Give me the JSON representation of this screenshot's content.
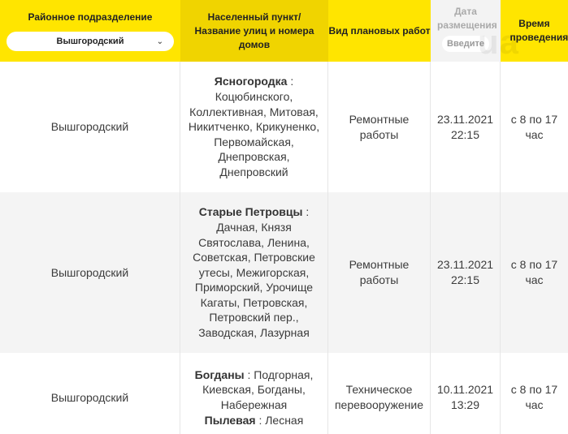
{
  "header": {
    "district_label": "Районное подразделение",
    "district_selected": "Вышгородский",
    "address_label": "Населенный пункт/Название улиц и номера домов",
    "work_type_label": "Вид плановых работ",
    "date_label": "Дата размещения",
    "date_placeholder": "Введите",
    "time_label": "Время проведения"
  },
  "watermark": "ua",
  "rows": [
    {
      "district": "Вышгородский",
      "places": [
        {
          "name": "Ясногородка",
          "streets": " : Коцюбинского, Коллективная, Митовая, Никитченко, Крикуненко, Первомайская, Днепровская, Днепровский"
        }
      ],
      "work_type": "Ремонтные работы",
      "date": "23.11.2021 22:15",
      "time": "с 8 по 17 час"
    },
    {
      "district": "Вышгородский",
      "places": [
        {
          "name": "Старые Петровцы",
          "streets": " : Дачная, Князя Святослава, Ленина, Советская, Петровские утесы, Межигорская, Приморский, Урочище Кагаты, Петровская, Петровский пер., Заводская, Лазурная"
        }
      ],
      "work_type": "Ремонтные работы",
      "date": "23.11.2021 22:15",
      "time": "с 8 по 17 час"
    },
    {
      "district": "Вышгородский",
      "places": [
        {
          "name": "Богданы",
          "streets": " : Подгорная, Киевская, Богданы, Набережная"
        },
        {
          "name": "Пылевая",
          "streets": " : Лесная"
        }
      ],
      "work_type": "Техническое перевооружение",
      "date": "10.11.2021 13:29",
      "time": "с 8 по 17 час"
    }
  ]
}
